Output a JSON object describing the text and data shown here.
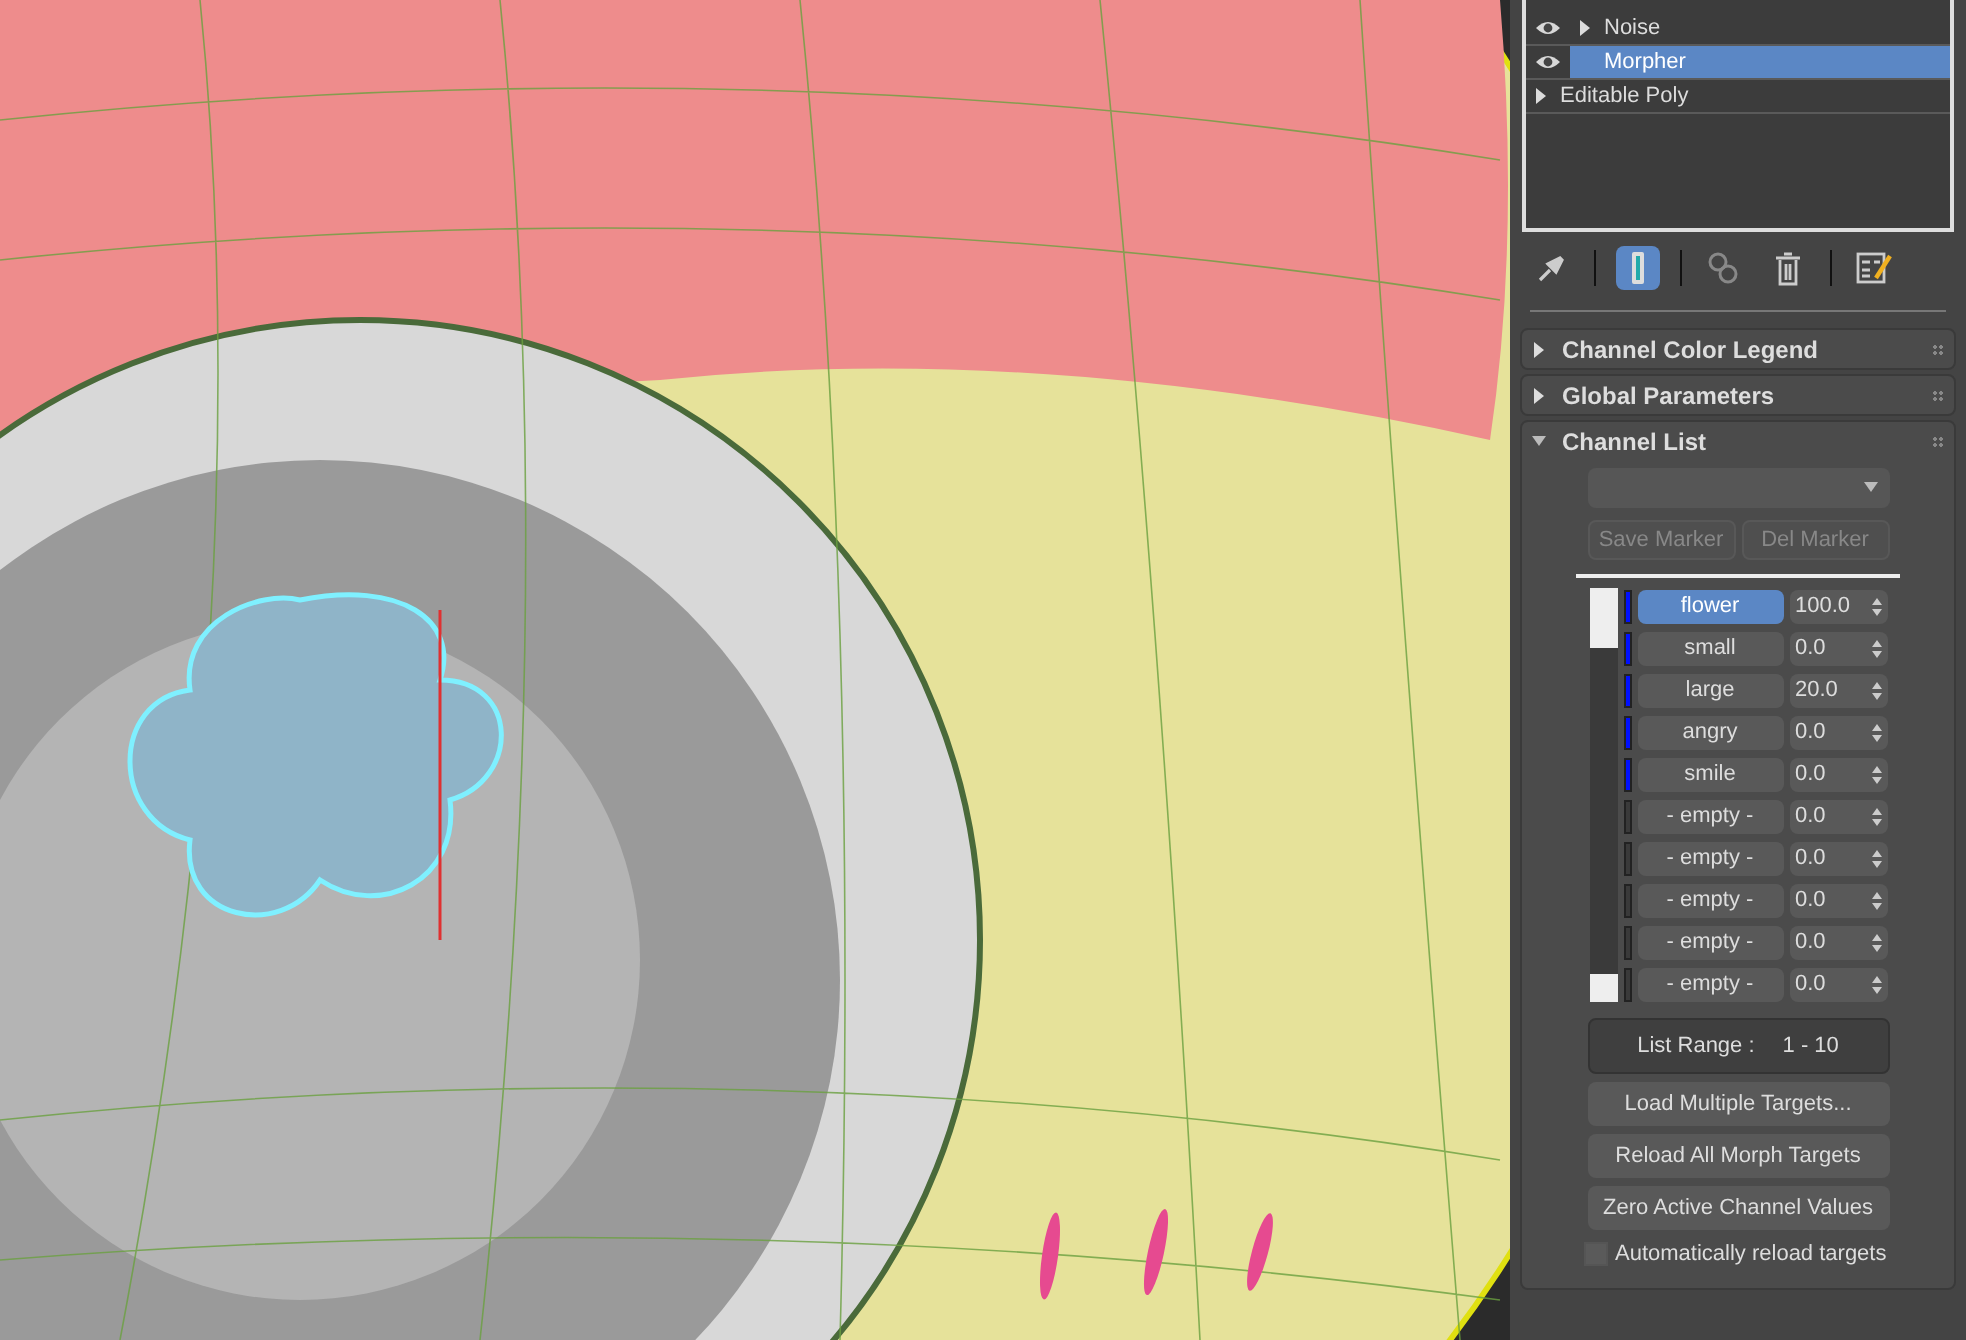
{
  "modifier_stack": [
    {
      "label": "Noise",
      "visible": true,
      "expandable": true,
      "selected": false
    },
    {
      "label": "Morpher",
      "visible": true,
      "expandable": false,
      "selected": true
    },
    {
      "label": "Editable Poly",
      "visible": false,
      "expandable": true,
      "selected": false
    }
  ],
  "toolbar": [
    {
      "kind": "pin",
      "active": false
    },
    {
      "kind": "show-end",
      "active": true
    },
    {
      "kind": "unique",
      "active": false
    },
    {
      "kind": "remove",
      "active": false
    },
    {
      "kind": "configure",
      "active": false
    }
  ],
  "rollouts": [
    {
      "title": "Channel Color Legend",
      "expanded": false
    },
    {
      "title": "Global Parameters",
      "expanded": false
    },
    {
      "title": "Channel List",
      "expanded": true
    }
  ],
  "marker_buttons": [
    "Save Marker",
    "Del Marker"
  ],
  "channels": [
    {
      "name": "flower",
      "value": "100.0",
      "has_target": true,
      "selected": true
    },
    {
      "name": "small",
      "value": "0.0",
      "has_target": true,
      "selected": false
    },
    {
      "name": "large",
      "value": "20.0",
      "has_target": true,
      "selected": false
    },
    {
      "name": "angry",
      "value": "0.0",
      "has_target": true,
      "selected": false
    },
    {
      "name": "smile",
      "value": "0.0",
      "has_target": true,
      "selected": false
    },
    {
      "name": "- empty -",
      "value": "0.0",
      "has_target": false,
      "selected": false
    },
    {
      "name": "- empty -",
      "value": "0.0",
      "has_target": false,
      "selected": false
    },
    {
      "name": "- empty -",
      "value": "0.0",
      "has_target": false,
      "selected": false
    },
    {
      "name": "- empty -",
      "value": "0.0",
      "has_target": false,
      "selected": false
    },
    {
      "name": "- empty -",
      "value": "0.0",
      "has_target": false,
      "selected": false
    }
  ],
  "list_range": {
    "label": "List Range :",
    "value": "1 - 10"
  },
  "buttons": [
    "Load Multiple Targets...",
    "Reload All Morph Targets",
    "Zero Active Channel Values"
  ],
  "auto_reload": {
    "label": "Automatically reload targets",
    "checked": false
  }
}
